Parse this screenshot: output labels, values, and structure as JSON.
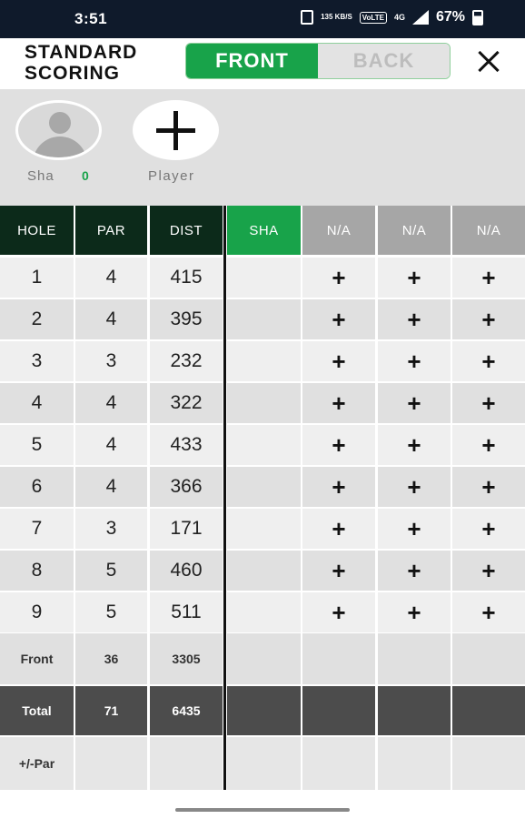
{
  "status_bar": {
    "time": "3:51",
    "net_speed": "135 KB/S",
    "volte": "VoLTE",
    "network": "4G",
    "battery": "67%"
  },
  "header": {
    "title": "STANDARD SCORING",
    "tab_front": "FRONT",
    "tab_back": "BACK",
    "active_tab": "FRONT"
  },
  "players": {
    "player1_name": "Sha",
    "player1_score": "0",
    "add_label": "Player"
  },
  "columns": [
    "HOLE",
    "PAR",
    "DIST",
    "SHA",
    "N/A",
    "N/A",
    "N/A"
  ],
  "holes": [
    {
      "hole": "1",
      "par": "4",
      "dist": "415"
    },
    {
      "hole": "2",
      "par": "4",
      "dist": "395"
    },
    {
      "hole": "3",
      "par": "3",
      "dist": "232"
    },
    {
      "hole": "4",
      "par": "4",
      "dist": "322"
    },
    {
      "hole": "5",
      "par": "4",
      "dist": "433"
    },
    {
      "hole": "6",
      "par": "4",
      "dist": "366"
    },
    {
      "hole": "7",
      "par": "3",
      "dist": "171"
    },
    {
      "hole": "8",
      "par": "5",
      "dist": "460"
    },
    {
      "hole": "9",
      "par": "5",
      "dist": "511"
    }
  ],
  "add_score_symbol": "+",
  "summary": {
    "front_label": "Front",
    "front_par": "36",
    "front_dist": "3305",
    "total_label": "Total",
    "total_par": "71",
    "total_dist": "6435",
    "par_diff_label": "+/-Par"
  },
  "colors": {
    "accent_green": "#18a34a",
    "header_dark": "#0c2a1a",
    "na_grey": "#a6a6a6",
    "total_row": "#4c4c4c"
  }
}
